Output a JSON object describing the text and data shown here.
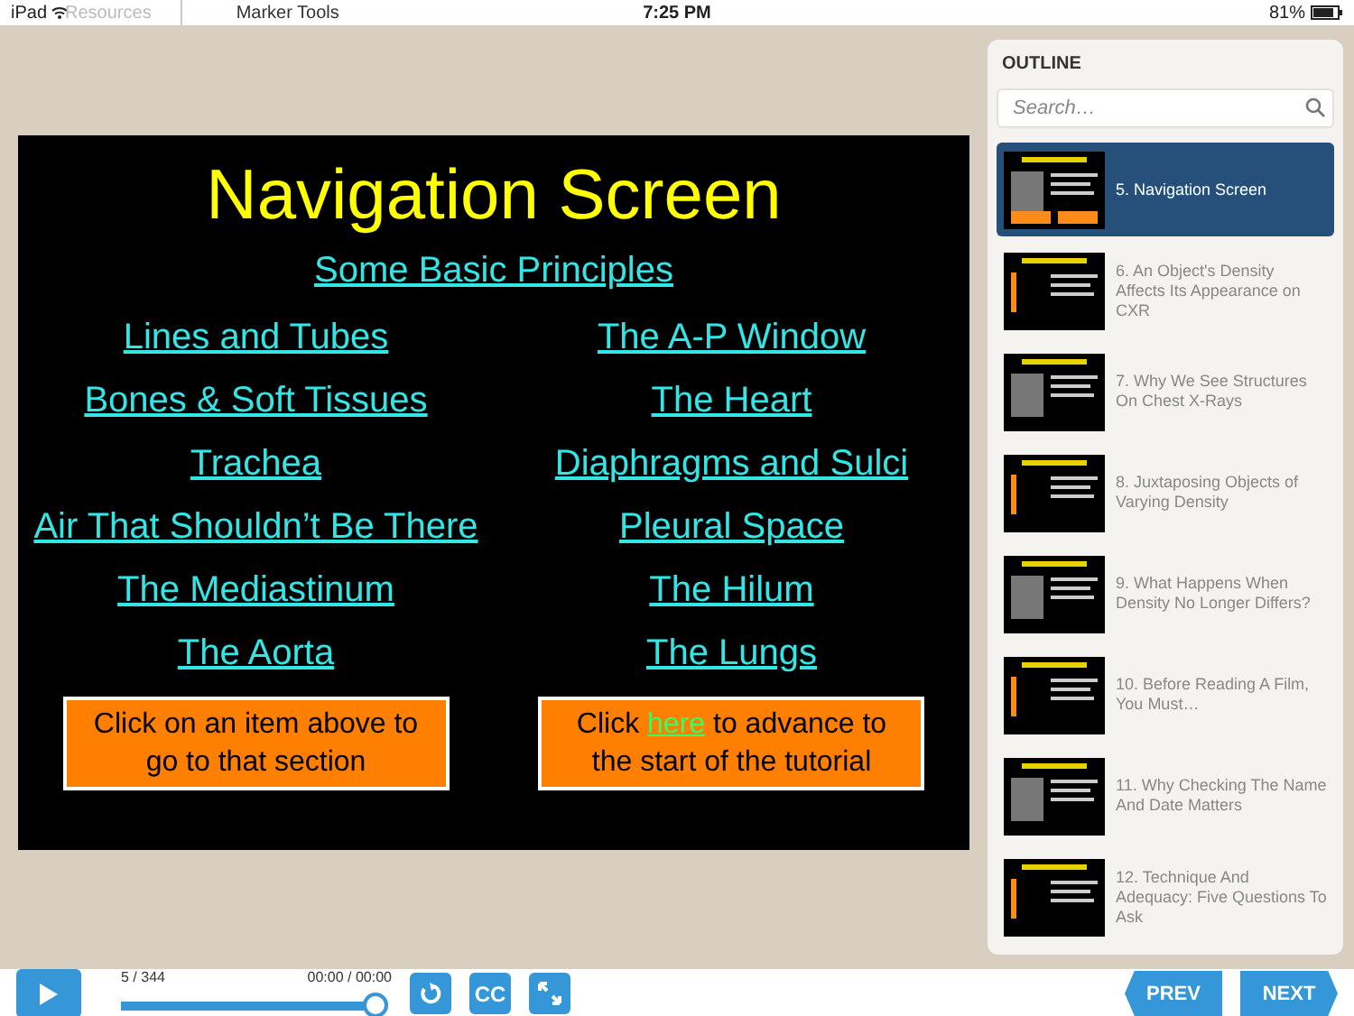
{
  "status_bar": {
    "device": "iPad",
    "time": "7:25 PM",
    "battery": "81%"
  },
  "toolbar": {
    "items": [
      "Resources",
      "Marker Tools"
    ]
  },
  "slide": {
    "title": "Navigation Screen",
    "top_link": "Some Basic Principles",
    "links": [
      [
        "Lines and Tubes",
        "The A-P Window"
      ],
      [
        "Bones & Soft Tissues",
        "The Heart"
      ],
      [
        "Trachea",
        "Diaphragms and Sulci"
      ],
      [
        "Air That Shouldn’t Be There",
        "Pleural Space"
      ],
      [
        "The Mediastinum",
        "The Hilum"
      ],
      [
        "The Aorta",
        "The Lungs"
      ]
    ],
    "boxes": [
      {
        "parts": [
          {
            "text": "Click on an item above to go to that section",
            "kind": "text"
          }
        ]
      },
      {
        "parts": [
          {
            "text": "Click ",
            "kind": "text"
          },
          {
            "text": "here",
            "kind": "link"
          },
          {
            "text": " to advance to the start of the tutorial",
            "kind": "text"
          }
        ]
      }
    ]
  },
  "outline": {
    "title": "OUTLINE",
    "search": {
      "placeholder": "Search…"
    },
    "items": [
      {
        "label": "5. Navigation Screen",
        "selected": true
      },
      {
        "label": "6. An Object's Density Affects Its Appearance on CXR",
        "selected": false
      },
      {
        "label": "7. Why We See Structures On Chest X-Rays",
        "selected": false
      },
      {
        "label": "8. Juxtaposing Objects of Varying Density",
        "selected": false
      },
      {
        "label": "9. What Happens When Density No Longer Differs?",
        "selected": false
      },
      {
        "label": "10. Before Reading A Film, You Must…",
        "selected": false
      },
      {
        "label": "11. Why Checking The Name And Date Matters",
        "selected": false
      },
      {
        "label": "12. Technique And Adequacy: Five Questions To Ask",
        "selected": false
      }
    ]
  },
  "player": {
    "slide_count": "5 / 344",
    "time": "00:00 / 00:00",
    "level": 1,
    "buttons": [
      "CC"
    ],
    "nav": [
      "PREV",
      "NEXT"
    ]
  }
}
